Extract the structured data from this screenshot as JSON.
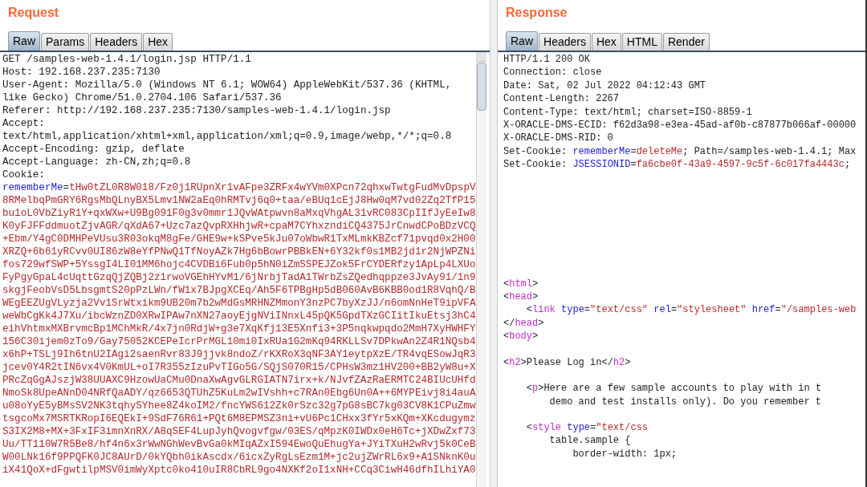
{
  "request": {
    "title": "Request",
    "tabs": [
      {
        "label": "Raw",
        "selected": true
      },
      {
        "label": "Params",
        "selected": false
      },
      {
        "label": "Headers",
        "selected": false
      },
      {
        "label": "Hex",
        "selected": false
      }
    ],
    "lines": [
      [
        {
          "kind": "text",
          "text": "GET /samples-web-1.4.1/login.jsp HTTP/1.1"
        }
      ],
      [
        {
          "kind": "text",
          "text": "Host: 192.168.237.235:7130"
        }
      ],
      [
        {
          "kind": "text",
          "text": "User-Agent: Mozilla/5.0 (Windows NT 6.1; WOW64) AppleWebKit/537.36 (KHTML,"
        }
      ],
      [
        {
          "kind": "text",
          "text": "like Gecko) Chrome/51.0.2704.106 Safari/537.36"
        }
      ],
      [
        {
          "kind": "text",
          "text": "Referer: http://192.168.237.235:7130/samples-web-1.4.1/login.jsp"
        }
      ],
      [
        {
          "kind": "text",
          "text": "Accept:"
        }
      ],
      [
        {
          "kind": "text",
          "text": "text/html,application/xhtml+xml,application/xml;q=0.9,image/webp,*/*;q=0.8"
        }
      ],
      [
        {
          "kind": "text",
          "text": "Accept-Encoding: gzip, deflate"
        }
      ],
      [
        {
          "kind": "text",
          "text": "Accept-Language: zh-CN,zh;q=0.8"
        }
      ],
      [
        {
          "kind": "text",
          "text": "Cookie:"
        }
      ],
      [
        {
          "kind": "name",
          "text": "rememberMe"
        },
        {
          "kind": "text",
          "text": "="
        },
        {
          "kind": "value",
          "text": "tHw0tZL0R8W018/Fz0j1RUpnXr1vAFpe3ZRFx4wYVm0XPcn72qhxwTwtgFudMvDpspV"
        }
      ],
      [
        {
          "kind": "value",
          "text": "8RMelbqPmGRY6RgsMbQLnyBX5Lmv1NW2aEq0hRMTvj6q0+taa/eBUq1cEjJ8Hw0qM7vd02Zq2TfP15"
        }
      ],
      [
        {
          "kind": "value",
          "text": "bu1oL0VbZiyR1Y+qxWXw+U9Bg091F0g3v0mmr1JQvWAtpwvn8aMxqVhgAL31vRC083CpIIfJyEeIw8"
        }
      ],
      [
        {
          "kind": "value",
          "text": "K0yFJFFddmuotZjvAGR/qXdA67+Uzc7azQvpRXHhjwR+cpaM7CYhxzndiCQ4375JrCnwdCPoBDzVCQ"
        }
      ],
      [
        {
          "kind": "value",
          "text": "+Ebm/Y4gC0DMHPeVUsu3R03okqM8gFe/GHE9w+kSPve5kJu07oWbwR1TxMLmkKBZcf71pvqd0x2H00"
        }
      ],
      [
        {
          "kind": "value",
          "text": "XRZQ+6b61yRCvv0UI86zW8eYfPNwQ1TfNoyAZk7Hg6bBowrPBBkEN+6Y32kf0s1MB2jd1r2NjWPZNi"
        }
      ],
      [
        {
          "kind": "value",
          "text": "fos729wfSWP+5YssgI4LI01MM6hojc4CVDBi6Fub0p5hN0iZmSSPEJZok5FrCYDERfzy1ApLp4LXUo"
        }
      ],
      [
        {
          "kind": "value",
          "text": "FyPgyGpaL4cUqttGzqQjZQBj2z1rwoVGEhHYvM1/6jNrbjTadA1TWrbZsZQedhqppze3JvAy91/1n9"
        }
      ],
      [
        {
          "kind": "value",
          "text": "skgjFeobVsD5LbsgmtS20pPzLWn/fW1x7BJpgXCEq/Ah5F6TPBgHp5dB060AvB6KBB0od1R8VqhQ/B"
        }
      ],
      [
        {
          "kind": "value",
          "text": "WEgEEZUgVLyzja2Vv1SrWtxikm9UB20m7b2wMdGsMRHNZMmonY3nzPC7byXzJJ/n6omNnHeT9ipVFA"
        }
      ],
      [
        {
          "kind": "value",
          "text": "weWbCgKk4J7Xu/ibcWznZD0XRwIPAw7nXN27aoyEjgNViINnxL45pQK5GpdTXzGCIitIkuEtsj3hC4"
        }
      ],
      [
        {
          "kind": "value",
          "text": "eihVhtmxMXBrvmcBp1MChMkR/4x7jn0RdjW+g3e7XqKfj13E5Xnfi3+3P5nqkwpqdo2MmH7XyHWHFY"
        }
      ],
      [
        {
          "kind": "value",
          "text": "156C30ijem0zTo9/Gay75052KCEPeIcrPrMGL10mi0IxRUa1G2mKq94RKLLSv7DPkwAn2Z4R1NQsb4"
        }
      ],
      [
        {
          "kind": "value",
          "text": "x6hP+TSLj9Ih6tnU2IAgi2saenRvr83J9jjvk8ndoZ/rKXRoX3qNF3AY1eytpXzE/TR4vqESowJqR3"
        }
      ],
      [
        {
          "kind": "value",
          "text": "jcev0Y4R2tIN6vx4V0KmUL+oI7R355zIzuPvTIGo5G/SQjS070R15/CPHsW3mz1HV200+BB2yW8u+X"
        }
      ],
      [
        {
          "kind": "value",
          "text": "PRcZqGgAJszjW38UUAXC9HzowUaCMu0DnaXwAgvGLRGIATN7irx+k/NJvfZAzRaERMTC24BIUcUHfd"
        }
      ],
      [
        {
          "kind": "value",
          "text": "NmoSk8UpeANnD04NRfQaADY/qz6653QTUhZ5KuLm2wIVshh+c7RAn0Ebg6Un0A++6MYPEivj8i4auA"
        }
      ],
      [
        {
          "kind": "value",
          "text": "u08oYyE5yBMsSV2NK3tqhySYhee8Z4koIM2/fncYWS612Zk0rSzc32g7pG8sBC7kg03CV8K1CPuZmw"
        }
      ],
      [
        {
          "kind": "value",
          "text": "tsgcoMx7MSRTKRopI6EQEkI+9SdF76R61+PQt6M8EPMSZ3ni+vU6Pc1CHxx3fYr5xKQm+XKcdugymz"
        }
      ],
      [
        {
          "kind": "value",
          "text": "S3IX2M8+MX+3FxIF3imnXnRX/A8qSEF4LupJyhQvogvfgw/03ES/qMpzK0IWDx0eH6Tc+jXDwZxf73"
        }
      ],
      [
        {
          "kind": "value",
          "text": "Uu/TT110W7R5Be8/hf4n6x3rWwNGhWevBvGa0kMIqAZxI594EwoQuEhugYa+JYiTXuH2wRvj5k0CeB"
        }
      ],
      [
        {
          "kind": "value",
          "text": "W00LNk16f9PPQFK0JC8AUrD/0kYQbh0ikAscdx/6icxZyRgLsEzm1M+jc2ujZWrRL6x9+A1SNknK0u"
        }
      ],
      [
        {
          "kind": "value",
          "text": "iX41QoX+dFgwtilpMSV0imWyXptc0ko410uIR8CbRL9go4NXKf2oI1xNH+CCq3CiwH46dfhILhiYA0"
        }
      ]
    ]
  },
  "response": {
    "title": "Response",
    "tabs": [
      {
        "label": "Raw",
        "selected": true
      },
      {
        "label": "Headers",
        "selected": false
      },
      {
        "label": "Hex",
        "selected": false
      },
      {
        "label": "HTML",
        "selected": false
      },
      {
        "label": "Render",
        "selected": false
      }
    ],
    "headers": [
      [
        {
          "kind": "text",
          "text": "HTTP/1.1 200 OK"
        }
      ],
      [
        {
          "kind": "text",
          "text": "Connection: close"
        }
      ],
      [
        {
          "kind": "text",
          "text": "Date: Sat, 02 Jul 2022 04:12:43 GMT"
        }
      ],
      [
        {
          "kind": "text",
          "text": "Content-Length: 2267"
        }
      ],
      [
        {
          "kind": "text",
          "text": "Content-Type: text/html; charset=ISO-8859-1"
        }
      ],
      [
        {
          "kind": "text",
          "text": "X-ORACLE-DMS-ECID: f62d3a98-e3ea-45ad-af0b-c87877b066af-00000"
        }
      ],
      [
        {
          "kind": "text",
          "text": "X-ORACLE-DMS-RID: 0"
        }
      ],
      [
        {
          "kind": "text",
          "text": "Set-Cookie: "
        },
        {
          "kind": "name",
          "text": "rememberMe"
        },
        {
          "kind": "text",
          "text": "="
        },
        {
          "kind": "value",
          "text": "deleteMe"
        },
        {
          "kind": "text",
          "text": "; Path=/samples-web-1.4.1; Max"
        }
      ],
      [
        {
          "kind": "text",
          "text": "Set-Cookie: "
        },
        {
          "kind": "name",
          "text": "JSESSIONID"
        },
        {
          "kind": "text",
          "text": "="
        },
        {
          "kind": "value",
          "text": "fa6cbe0f-43a9-4597-9c5f-6c017fa4443c"
        },
        {
          "kind": "text",
          "text": ";"
        }
      ]
    ],
    "body_blocks": [
      [
        [
          {
            "kind": "text",
            "text": "<"
          },
          {
            "kind": "tag",
            "text": "html"
          },
          {
            "kind": "text",
            "text": ">"
          }
        ],
        [
          {
            "kind": "text",
            "text": "<"
          },
          {
            "kind": "tag",
            "text": "head"
          },
          {
            "kind": "text",
            "text": ">"
          }
        ],
        [
          {
            "kind": "text",
            "text": "    <"
          },
          {
            "kind": "tag",
            "text": "link"
          },
          {
            "kind": "name",
            "text": " type"
          },
          {
            "kind": "text",
            "text": "="
          },
          {
            "kind": "value",
            "text": "\"text/css\""
          },
          {
            "kind": "name",
            "text": " rel"
          },
          {
            "kind": "text",
            "text": "="
          },
          {
            "kind": "value",
            "text": "\"stylesheet\""
          },
          {
            "kind": "name",
            "text": " href"
          },
          {
            "kind": "text",
            "text": "="
          },
          {
            "kind": "value",
            "text": "\"/samples-web"
          }
        ],
        [
          {
            "kind": "text",
            "text": "</"
          },
          {
            "kind": "tag",
            "text": "head"
          },
          {
            "kind": "text",
            "text": ">"
          }
        ],
        [
          {
            "kind": "text",
            "text": "<"
          },
          {
            "kind": "tag",
            "text": "body"
          },
          {
            "kind": "text",
            "text": ">"
          }
        ]
      ],
      [
        [
          {
            "kind": "text",
            "text": "<"
          },
          {
            "kind": "tag",
            "text": "h2"
          },
          {
            "kind": "text",
            "text": ">Please Log in</"
          },
          {
            "kind": "tag",
            "text": "h2"
          },
          {
            "kind": "text",
            "text": ">"
          }
        ]
      ],
      [
        [
          {
            "kind": "text",
            "text": "    <"
          },
          {
            "kind": "tag",
            "text": "p"
          },
          {
            "kind": "text",
            "text": ">Here are a few sample accounts to play with in t"
          }
        ],
        [
          {
            "kind": "text",
            "text": "        demo and test installs only). Do you remember t"
          }
        ]
      ],
      [
        [
          {
            "kind": "text",
            "text": "    <"
          },
          {
            "kind": "tag",
            "text": "style"
          },
          {
            "kind": "name",
            "text": " type"
          },
          {
            "kind": "text",
            "text": "="
          },
          {
            "kind": "value",
            "text": "\"text/css"
          }
        ],
        [
          {
            "kind": "text",
            "text": "        table.sample {"
          }
        ],
        [
          {
            "kind": "text",
            "text": "            border-width: 1px;"
          }
        ]
      ]
    ]
  }
}
